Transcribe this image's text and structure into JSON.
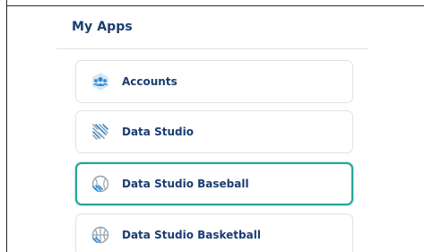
{
  "section": {
    "title": "My Apps"
  },
  "apps": [
    {
      "label": "Accounts",
      "icon": "accounts-icon",
      "selected": false
    },
    {
      "label": "Data Studio",
      "icon": "data-studio-icon",
      "selected": false
    },
    {
      "label": "Data Studio Baseball",
      "icon": "baseball-icon",
      "selected": true
    },
    {
      "label": "Data Studio Basketball",
      "icon": "basketball-icon",
      "selected": false
    }
  ],
  "colors": {
    "title": "#1a3d70",
    "label": "#1a3d70",
    "accent": "#1fa69a",
    "icon_blue": "#2b8bd8"
  }
}
